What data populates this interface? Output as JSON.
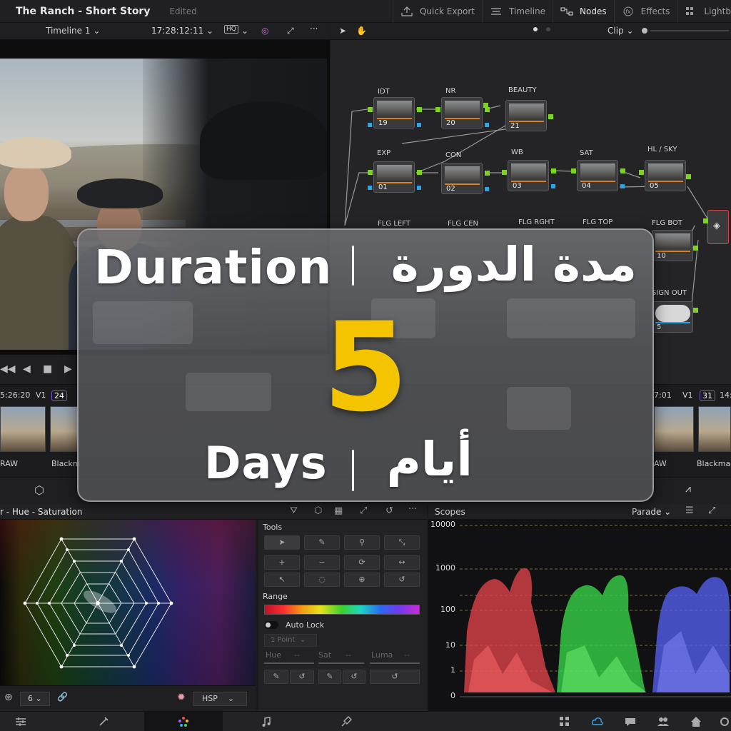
{
  "app": {
    "project_title": "The Ranch - Short Story",
    "project_status": "Edited"
  },
  "topnav": {
    "items": [
      {
        "label": "Quick Export",
        "icon": "export-icon"
      },
      {
        "label": "Timeline",
        "icon": "timeline-icon"
      },
      {
        "label": "Nodes",
        "icon": "nodes-icon"
      },
      {
        "label": "Effects",
        "icon": "fx-icon"
      },
      {
        "label": "Lightb",
        "icon": "lightbox-icon"
      }
    ]
  },
  "viewer_toolbar": {
    "timeline_name": "Timeline 1",
    "timecode": "17:28:12:11",
    "hq_badge": "HQ"
  },
  "node_toolbar": {
    "mode": "Clip"
  },
  "nodes": [
    {
      "label": "IDT",
      "num": "19"
    },
    {
      "label": "NR",
      "num": "20"
    },
    {
      "label": "BEAUTY",
      "num": "21"
    },
    {
      "label": "EXP",
      "num": "01"
    },
    {
      "label": "CON",
      "num": "02"
    },
    {
      "label": "WB",
      "num": "03"
    },
    {
      "label": "SAT",
      "num": "04"
    },
    {
      "label": "HL / SKY",
      "num": "05"
    },
    {
      "label": "FLG LEFT",
      "num": ""
    },
    {
      "label": "FLG CEN",
      "num": ""
    },
    {
      "label": "FLG RGHT",
      "num": ""
    },
    {
      "label": "FLG TOP",
      "num": ""
    },
    {
      "label": "FLG BOT",
      "num": "10"
    },
    {
      "label": "SIGN OUT",
      "num": "5"
    }
  ],
  "clip_strip": {
    "left_timecode": "5:26:20",
    "left_track": "V1",
    "left_badge": "24",
    "left_codec": "RAW",
    "left_codec2": "Blackm",
    "right_timecode": "7:01",
    "right_track": "V1",
    "right_badge": "31",
    "right_timecode2": "14:",
    "right_codec": "AW",
    "right_codec2": "Blackmag"
  },
  "qualifier": {
    "title": "r - Hue - Saturation",
    "softness_value": "6",
    "color_space": "HSP"
  },
  "tools": {
    "title": "Tools",
    "range_label": "Range",
    "auto_lock": "Auto Lock",
    "point_select": "1 Point",
    "hue_label": "Hue",
    "sat_label": "Sat",
    "luma_label": "Luma",
    "dash": "--"
  },
  "scopes": {
    "title": "Scopes",
    "mode": "Parade",
    "axis_labels": [
      "10000",
      "1000",
      "100",
      "10",
      "1",
      "0"
    ]
  },
  "overlay": {
    "duration_en": "Duration",
    "duration_ar": "مدة الدورة",
    "number": "5",
    "days_en": "Days",
    "days_ar": "أيام"
  },
  "colors": {
    "accent_yellow": "#f5c400",
    "node_port_green": "#7ed321",
    "node_port_blue": "#2aa6e8",
    "node_bar_orange": "#d6821e"
  }
}
